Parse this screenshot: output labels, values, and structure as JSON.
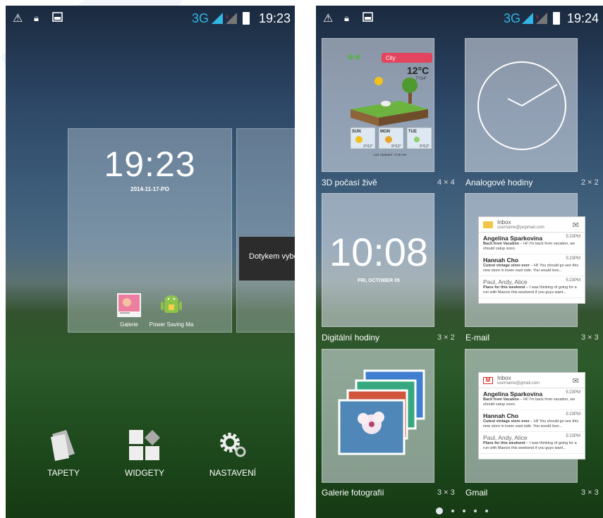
{
  "left": {
    "status": {
      "network": "3G",
      "time": "19:23"
    },
    "lock_clock": {
      "time": "19:23",
      "date": "2014-11-17-PO"
    },
    "toast": "Dotykem vyberte",
    "apps": [
      {
        "name": "Galerie",
        "icon": "gallery-icon"
      },
      {
        "name": "Power Saving Ma",
        "icon": "android-icon"
      }
    ],
    "bottom_bar": [
      {
        "label": "TAPETY",
        "icon": "wallpaper-icon"
      },
      {
        "label": "WIDGETY",
        "icon": "widgets-icon"
      },
      {
        "label": "NASTAVENÍ",
        "icon": "settings-icon"
      }
    ]
  },
  "right": {
    "status": {
      "network": "3G",
      "time": "19:24"
    },
    "weather": {
      "city": "City",
      "temp": "12°C",
      "range": "7°/14°",
      "days": [
        "SUN",
        "MON",
        "TUE"
      ],
      "day_ranges": [
        "3°/12°",
        "9°/12°",
        "9°/12°"
      ],
      "updated": "Last Updated : 5:36 AM"
    },
    "digital_clock": {
      "time": "10:08",
      "date": "FRI, OCTOBER 05"
    },
    "widgets": [
      {
        "name": "3D počasí živě",
        "size": "4 × 4"
      },
      {
        "name": "Analogové hodiny",
        "size": "2 × 2"
      },
      {
        "name": "Digitální hodiny",
        "size": "3 × 2"
      },
      {
        "name": "E-mail",
        "size": "3 × 3"
      },
      {
        "name": "Galerie fotografií",
        "size": "3 × 3"
      },
      {
        "name": "Gmail",
        "size": "3 × 3"
      }
    ],
    "email": {
      "inbox": "Inbox",
      "account": "username@popmail.com",
      "messages": [
        {
          "from": "Angelina Sparkovina",
          "time": "5:23PM",
          "subject": "Back from Vacation",
          "snippet": " – Hi! I'm back from vacation, we should catup soon."
        },
        {
          "from": "Hannah Cho",
          "time": "5:23PM",
          "subject": "Cutest vintage store ever",
          "snippet": " – Hi! You should go see this new store in lower east side. You would love..."
        },
        {
          "from": "Paul, Andy, Alice",
          "time": "5:23PM",
          "subject": "Plans for this weekend",
          "snippet": " – I was thinking of going for a run with Maecie this weekend if you guys want..."
        }
      ]
    },
    "gmail": {
      "inbox": "Inbox",
      "account": "username@gmail.com"
    },
    "page_dots": 5
  },
  "colors": {
    "accent": "#33b5e5",
    "signal_orange": "#e98a2c",
    "signal_red": "#d32f2f"
  }
}
